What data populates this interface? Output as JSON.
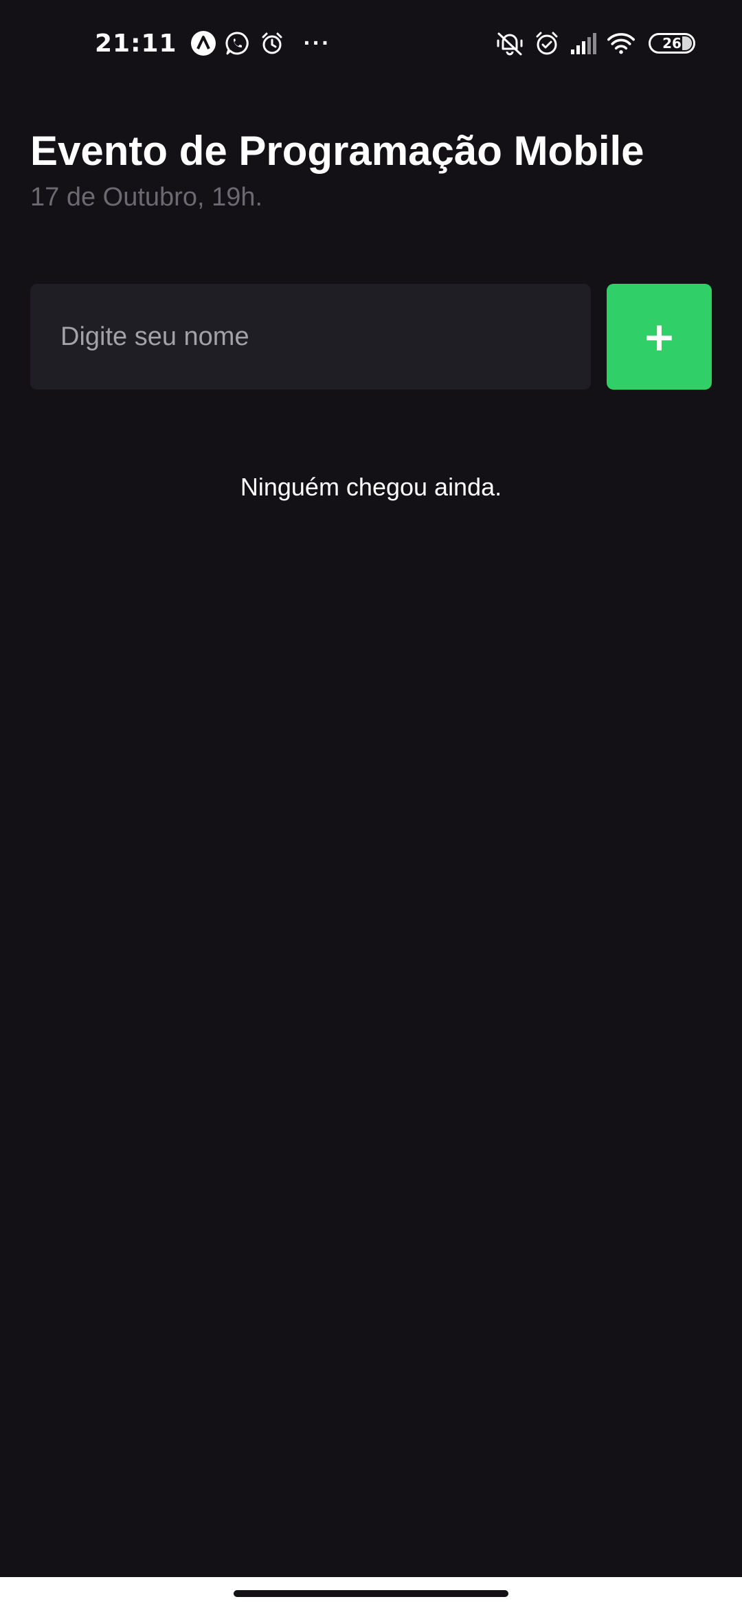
{
  "status_bar": {
    "time": "21:11",
    "left_icons": [
      "app-notification-icon",
      "whatsapp-icon",
      "alarm-icon"
    ],
    "more_indicator": "···",
    "right_icons": [
      "vibrate-off-icon",
      "alarm-icon",
      "signal-icon",
      "wifi-icon"
    ],
    "battery": "26"
  },
  "header": {
    "title": "Evento de Programação Mobile",
    "date": "17 de Outubro, 19h."
  },
  "form": {
    "name_input": {
      "placeholder": "Digite seu nome",
      "value": ""
    },
    "add_button_label": "+"
  },
  "participants": {
    "empty_message": "Ninguém chegou ainda."
  },
  "colors": {
    "background": "#131016",
    "input_background": "#1f1e24",
    "accent_green": "#31cf67",
    "subtitle_gray": "#6c6a70"
  }
}
